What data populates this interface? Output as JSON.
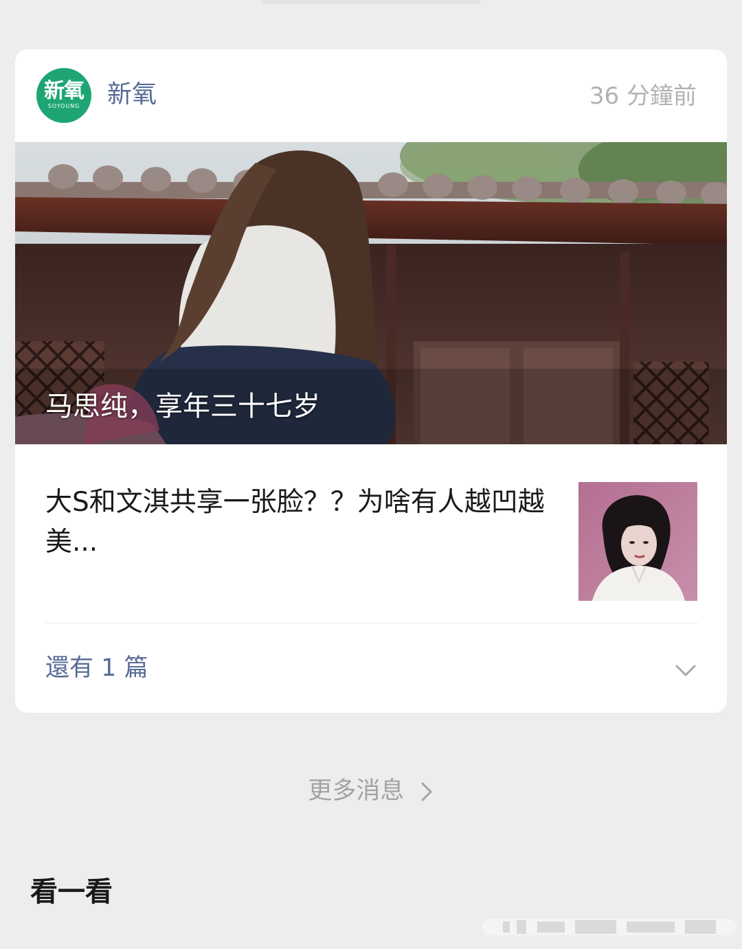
{
  "account": {
    "logo_text": "新氧",
    "logo_subtext": "SOYOUNG",
    "name": "新氧",
    "time": "36 分鐘前",
    "brand_color": "#1fa574"
  },
  "cover": {
    "title": "马思纯，享年三十七岁"
  },
  "article": {
    "title": "大S和文淇共享一张脸？？为啥有人越凹越美..."
  },
  "more": {
    "label": "還有 1 篇",
    "icon": "chevron-down-icon"
  },
  "more_messages": {
    "label": "更多消息",
    "icon": "chevron-right-icon"
  },
  "section": {
    "title": "看一看"
  },
  "colors": {
    "background": "#ededed",
    "card": "#ffffff",
    "link": "#576b95",
    "muted": "#b2b2b2",
    "text": "#191919"
  }
}
